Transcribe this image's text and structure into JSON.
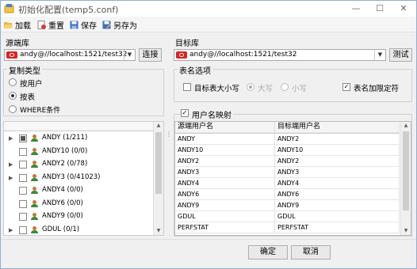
{
  "window": {
    "title": "初始化配置(temp5.conf)",
    "min_glyph": "—",
    "max_glyph": "☐",
    "close_glyph": "✕"
  },
  "toolbar": {
    "load": "加载",
    "reset": "重置",
    "save": "保存",
    "save_as": "另存为"
  },
  "source": {
    "title": "源端库",
    "connection": "andy@//localhost:1521/test32",
    "connect_button": "连接",
    "copy_type": {
      "title": "复制类型",
      "options": [
        {
          "label": "按用户",
          "selected": false
        },
        {
          "label": "按表",
          "selected": true
        },
        {
          "label": "WHERE条件",
          "selected": false
        }
      ]
    },
    "users": [
      {
        "name": "ANDY (1/211)",
        "expandable": true,
        "checked": "partial"
      },
      {
        "name": "ANDY10 (0/0)",
        "expandable": false,
        "checked": "none"
      },
      {
        "name": "ANDY2 (0/78)",
        "expandable": true,
        "checked": "none"
      },
      {
        "name": "ANDY3 (0/41023)",
        "expandable": true,
        "checked": "none"
      },
      {
        "name": "ANDY4 (0/0)",
        "expandable": false,
        "checked": "none"
      },
      {
        "name": "ANDY6 (0/0)",
        "expandable": false,
        "checked": "none"
      },
      {
        "name": "ANDY9 (0/0)",
        "expandable": false,
        "checked": "none"
      },
      {
        "name": "GDUL (0/1)",
        "expandable": true,
        "checked": "none"
      }
    ]
  },
  "target": {
    "title": "目标库",
    "connection": "andy@//localhost:1521/test32",
    "test_button": "测试",
    "table_name_options": {
      "title": "表名选项",
      "case_checkbox": "目标表大小写",
      "upper": "大写",
      "lower": "小写",
      "delimiter_checkbox": "表名加限定符"
    },
    "user_mapping": {
      "title": "用户名映射",
      "columns": [
        "源端用户名",
        "目标端用户名"
      ],
      "rows": [
        [
          "ANDY",
          "ANDY2"
        ],
        [
          "ANDY10",
          "ANDY10"
        ],
        [
          "ANDY2",
          "ANDY2"
        ],
        [
          "ANDY3",
          "ANDY3"
        ],
        [
          "ANDY4",
          "ANDY4"
        ],
        [
          "ANDY6",
          "ANDY6"
        ],
        [
          "ANDY9",
          "ANDY9"
        ],
        [
          "GDUL",
          "GDUL"
        ],
        [
          "PERFSTAT",
          "PERFSTAT"
        ]
      ]
    }
  },
  "footer": {
    "ok": "确定",
    "cancel": "取消"
  },
  "colors": {
    "accent_red": "#d22222",
    "border_blue": "#8fb1d6"
  }
}
